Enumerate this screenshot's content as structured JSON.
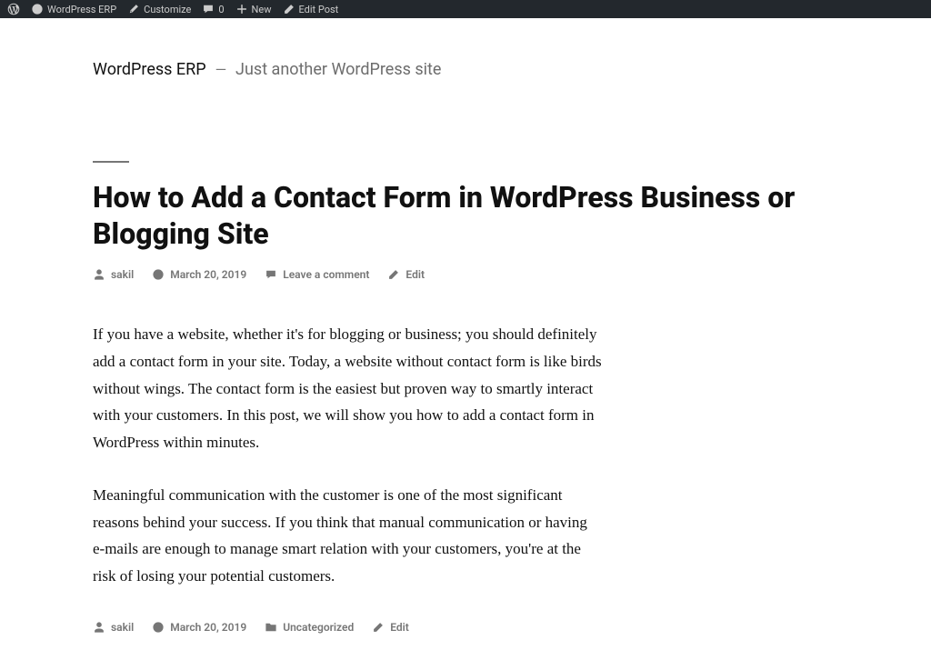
{
  "adminBar": {
    "siteName": "WordPress ERP",
    "customize": "Customize",
    "commentsCount": "0",
    "new": "New",
    "editPost": "Edit Post"
  },
  "siteHeader": {
    "title": "WordPress ERP",
    "separator": "—",
    "tagline": "Just another WordPress site"
  },
  "post": {
    "title": "How to Add a Contact Form in WordPress Business or Blogging Site",
    "metaTop": {
      "author": "sakil",
      "date": "March 20, 2019",
      "comment": "Leave a comment",
      "edit": "Edit"
    },
    "paragraphs": [
      "If you have a website, whether it's for blogging or business; you should definitely add a contact form in your site. Today, a website without contact form is like birds without wings. The contact form is the easiest but proven way to smartly interact with your customers. In this post, we will show you how to add a contact form in WordPress within minutes.",
      "Meaningful communication with the customer is one of the most significant reasons behind your success. If you think that manual communication or having e-mails are enough to manage smart relation with your customers, you're at the risk of losing your potential customers."
    ],
    "metaBottom": {
      "author": "sakil",
      "date": "March 20, 2019",
      "category": "Uncategorized",
      "edit": "Edit"
    }
  }
}
